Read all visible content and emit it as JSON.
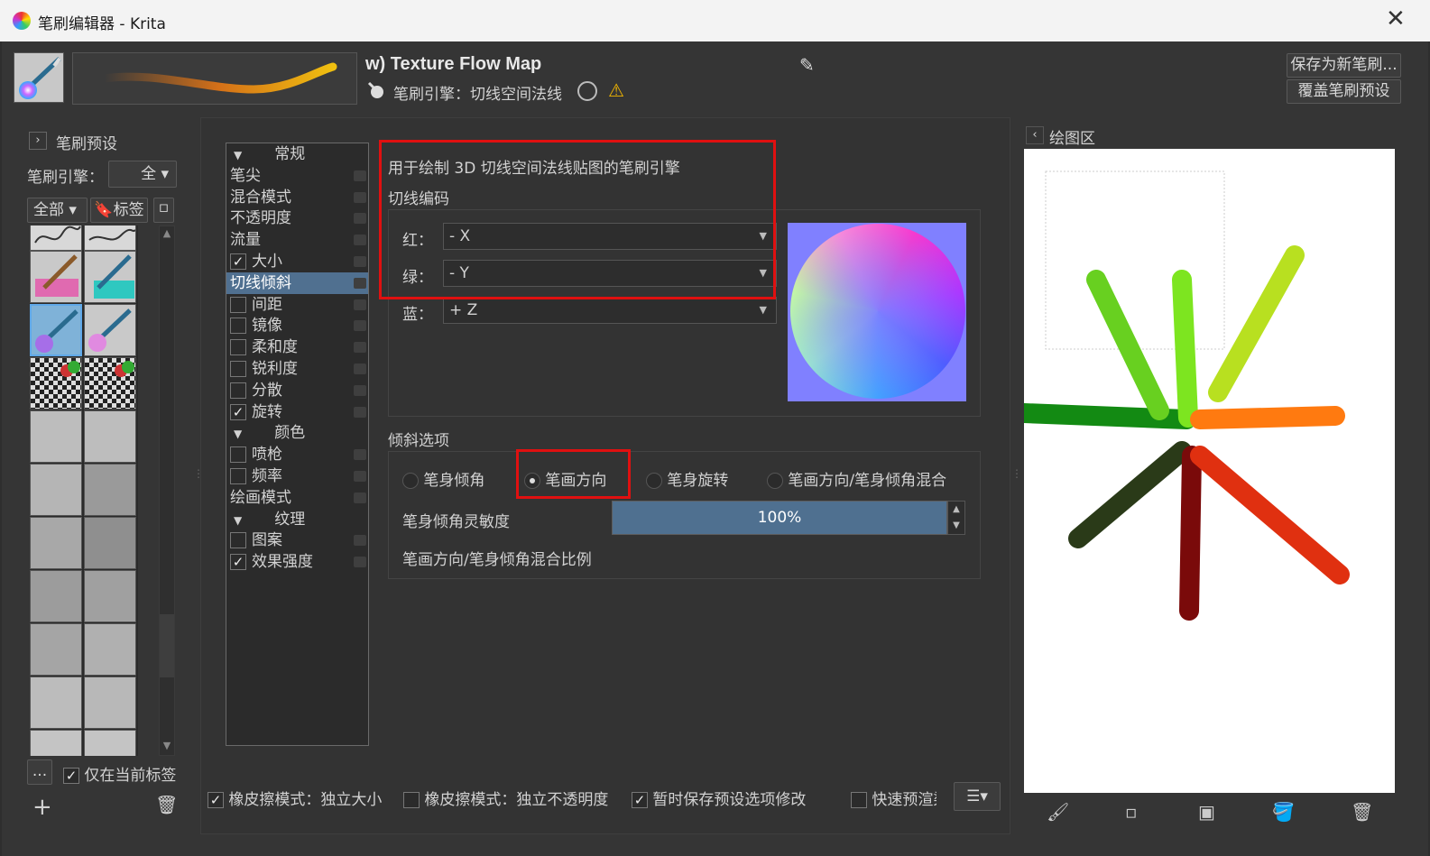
{
  "window": {
    "title": "笔刷编辑器 - Krita",
    "close_label": "✕"
  },
  "header": {
    "preset_name": "w) Texture Flow Map",
    "engine_label": "笔刷引擎：切线空间法线",
    "save_new_label": "保存为新笔刷...",
    "overwrite_label": "覆盖笔刷预设",
    "warn_symbol": "⚠",
    "edit_symbol": "✎"
  },
  "left_panel": {
    "title": "笔刷预设",
    "engine_label": "笔刷引擎：",
    "engine_value": "全",
    "filter_all": "全部",
    "tag_label": "标签",
    "dots": "...",
    "only_current_label": "仅在当前标签",
    "only_current_checked": true,
    "add_symbol": "+",
    "trash_symbol": "🗑"
  },
  "options_tree": [
    {
      "label": "常规",
      "type": "header"
    },
    {
      "label": "笔尖",
      "type": "item"
    },
    {
      "label": "混合模式",
      "type": "item"
    },
    {
      "label": "不透明度",
      "type": "item"
    },
    {
      "label": "流量",
      "type": "item"
    },
    {
      "label": "大小",
      "type": "check",
      "checked": true
    },
    {
      "label": "切线倾斜",
      "type": "item",
      "selected": true
    },
    {
      "label": "间距",
      "type": "check",
      "checked": false
    },
    {
      "label": "镜像",
      "type": "check",
      "checked": false
    },
    {
      "label": "柔和度",
      "type": "check",
      "checked": false
    },
    {
      "label": "锐利度",
      "type": "check",
      "checked": false
    },
    {
      "label": "分散",
      "type": "check",
      "checked": false
    },
    {
      "label": "旋转",
      "type": "check",
      "checked": true
    },
    {
      "label": "颜色",
      "type": "header"
    },
    {
      "label": "喷枪",
      "type": "check",
      "checked": false
    },
    {
      "label": "频率",
      "type": "check",
      "checked": false
    },
    {
      "label": "绘画模式",
      "type": "item"
    },
    {
      "label": "纹理",
      "type": "header"
    },
    {
      "label": "图案",
      "type": "check",
      "checked": false
    },
    {
      "label": "效果强度",
      "type": "check",
      "checked": true
    }
  ],
  "tangent": {
    "description": "用于绘制 3D 切线空间法线贴图的笔刷引擎",
    "encoding_label": "切线编码",
    "red_label": "红：",
    "red_value": "- X",
    "green_label": "绿：",
    "green_value": "- Y",
    "blue_label": "蓝：",
    "blue_value": "+ Z"
  },
  "tilt": {
    "section_label": "倾斜选项",
    "options": [
      {
        "label": "笔身倾角",
        "selected": false
      },
      {
        "label": "笔画方向",
        "selected": true
      },
      {
        "label": "笔身旋转",
        "selected": false
      },
      {
        "label": "笔画方向/笔身倾角混合",
        "selected": false
      }
    ],
    "sensitivity_label": "笔身倾角灵敏度",
    "sensitivity_value": "100%",
    "sensitivity_fraction": 1.0,
    "mix_label": "笔画方向/笔身倾角混合比例",
    "spin_up": "▲",
    "spin_down": "▼"
  },
  "bottom": {
    "eraser_size_label": "橡皮擦模式：独立大小",
    "eraser_size_checked": true,
    "eraser_opacity_label": "橡皮擦模式：独立不透明度",
    "eraser_opacity_checked": false,
    "temp_save_label": "暂时保存预设选项修改",
    "temp_save_checked": true,
    "fast_preview_label": "快速预渲染",
    "fast_preview_checked": false,
    "menu_symbol": "☰▾"
  },
  "scratchpad": {
    "title": "绘图区",
    "chevron": "‹"
  },
  "colors": {
    "accent": "#507090",
    "highlight_box": "#e01010",
    "background": "#353535"
  }
}
